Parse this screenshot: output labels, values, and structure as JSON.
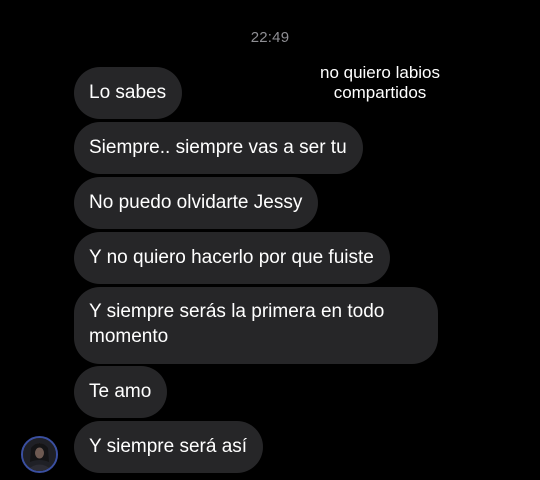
{
  "header": {
    "timestamp": "22:49"
  },
  "overlay": {
    "caption": "no quiero labios compartidos"
  },
  "messages": [
    {
      "text": "Lo sabes"
    },
    {
      "text": "Siempre.. siempre vas a ser tu"
    },
    {
      "text": "No puedo olvidarte Jessy"
    },
    {
      "text": "Y no quiero hacerlo por que fuiste"
    },
    {
      "text": "Y siempre serás la primera en todo momento"
    },
    {
      "text": "Te amo"
    },
    {
      "text": "Y siempre será así"
    }
  ],
  "sender": {
    "avatar_icon": "user-avatar"
  },
  "colors": {
    "background": "#000000",
    "bubble": "#262628",
    "timestamp": "#8e8e93"
  }
}
